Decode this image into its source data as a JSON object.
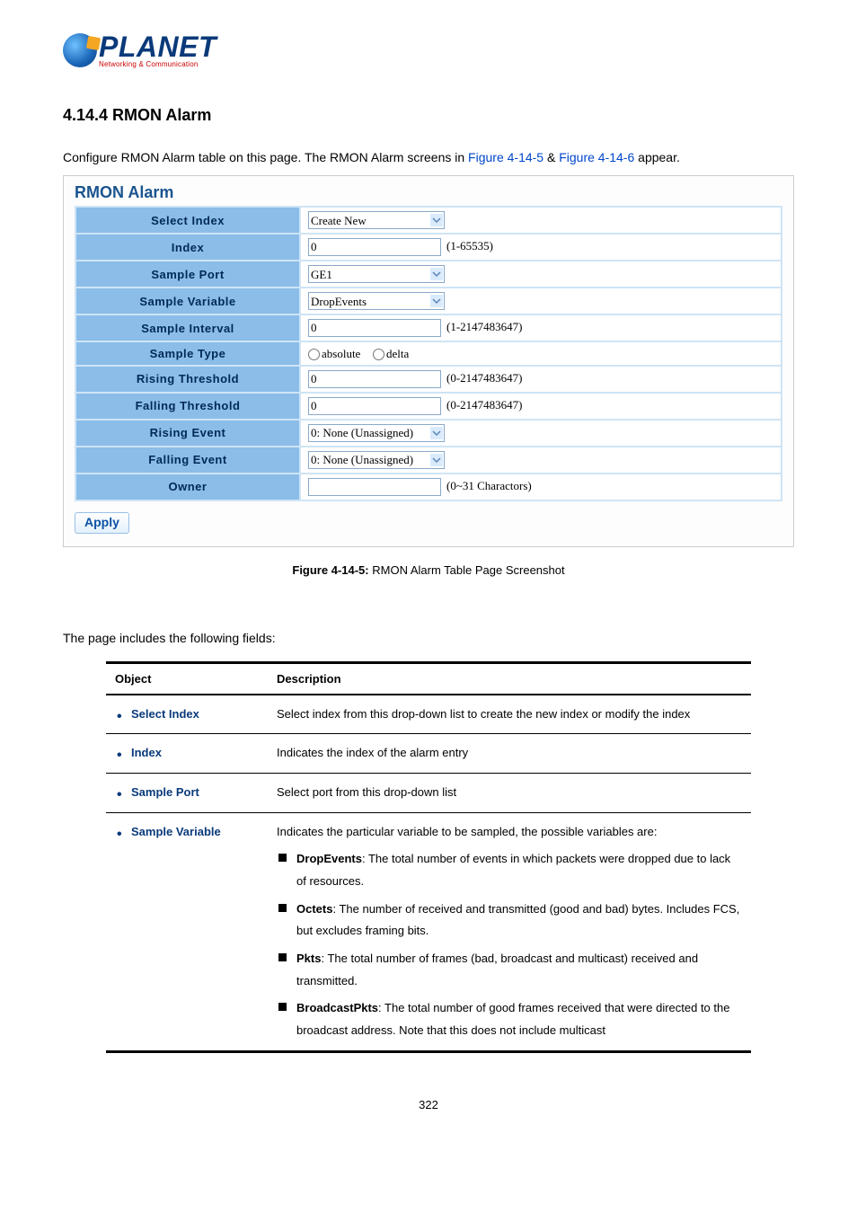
{
  "logo": {
    "brand": "PLANET",
    "tagline": "Networking & Communication"
  },
  "heading": "4.14.4 RMON Alarm",
  "intro": {
    "pre": "Configure RMON Alarm table on this page. The RMON Alarm screens in ",
    "link1": "Figure 4-14-5",
    "mid": " & ",
    "link2": "Figure 4-14-6",
    "post": " appear."
  },
  "panel": {
    "title": "RMON Alarm",
    "rows": {
      "select_index": {
        "label": "Select Index",
        "value": "Create New"
      },
      "index": {
        "label": "Index",
        "value": "0",
        "hint": "(1-65535)"
      },
      "sample_port": {
        "label": "Sample Port",
        "value": "GE1"
      },
      "sample_var": {
        "label": "Sample Variable",
        "value": "DropEvents"
      },
      "sample_int": {
        "label": "Sample Interval",
        "value": "0",
        "hint": "(1-2147483647)"
      },
      "sample_type": {
        "label": "Sample Type",
        "opt1": "absolute",
        "opt2": "delta"
      },
      "rising_thr": {
        "label": "Rising Threshold",
        "value": "0",
        "hint": "(0-2147483647)"
      },
      "falling_thr": {
        "label": "Falling Threshold",
        "value": "0",
        "hint": "(0-2147483647)"
      },
      "rising_evt": {
        "label": "Rising Event",
        "value": "0: None (Unassigned)"
      },
      "falling_evt": {
        "label": "Falling Event",
        "value": "0: None (Unassigned)"
      },
      "owner": {
        "label": "Owner",
        "value": "",
        "hint": "(0~31 Charactors)"
      }
    },
    "apply": "Apply"
  },
  "caption": {
    "b": "Figure 4-14-5:",
    "rest": " RMON Alarm Table Page Screenshot"
  },
  "fields_intro": "The page includes the following fields:",
  "desc": {
    "h1": "Object",
    "h2": "Description",
    "rows": [
      {
        "obj": "Select Index",
        "d": "Select index from this drop-down list to create the new index or modify the index"
      },
      {
        "obj": "Index",
        "d": "Indicates the index of the alarm entry"
      },
      {
        "obj": "Sample Port",
        "d": "Select port from this drop-down list"
      },
      {
        "obj": "Sample Variable",
        "lead": "Indicates the particular variable to be sampled, the possible variables are:",
        "items": [
          {
            "b": "DropEvents",
            "t": ": The total number of events in which packets were dropped due to lack of resources."
          },
          {
            "b": "Octets",
            "t": ": The number of received and transmitted (good and bad) bytes. Includes FCS, but excludes framing bits."
          },
          {
            "b": "Pkts",
            "t": ": The total number of frames (bad, broadcast and multicast) received and transmitted."
          },
          {
            "b": "BroadcastPkts",
            "t": ": The total number of good frames received that were directed to the broadcast address. Note that this does not include multicast"
          }
        ]
      }
    ]
  },
  "pagenum": "322"
}
